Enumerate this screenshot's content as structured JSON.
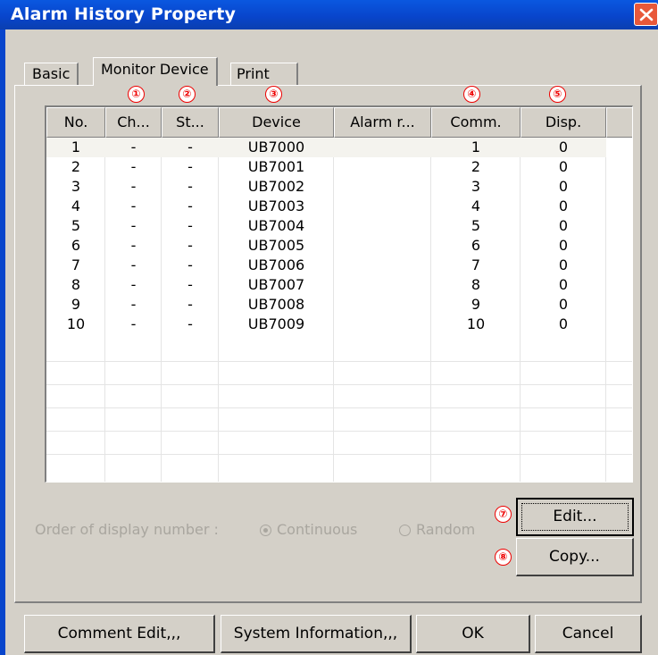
{
  "window": {
    "title": "Alarm History Property"
  },
  "tabs": [
    {
      "label": "Basic"
    },
    {
      "label": "Monitor Device"
    },
    {
      "label": "Print"
    }
  ],
  "markers": [
    "①",
    "②",
    "③",
    "④",
    "⑤",
    "⑦",
    "⑧"
  ],
  "grid": {
    "headers": [
      "No.",
      "Ch...",
      "St...",
      "Device",
      "Alarm r...",
      "Comm.",
      "Disp."
    ],
    "rows": [
      [
        "1",
        "-",
        "-",
        "UB7000",
        "",
        "1",
        "0"
      ],
      [
        "2",
        "-",
        "-",
        "UB7001",
        "",
        "2",
        "0"
      ],
      [
        "3",
        "-",
        "-",
        "UB7002",
        "",
        "3",
        "0"
      ],
      [
        "4",
        "-",
        "-",
        "UB7003",
        "",
        "4",
        "0"
      ],
      [
        "5",
        "-",
        "-",
        "UB7004",
        "",
        "5",
        "0"
      ],
      [
        "6",
        "-",
        "-",
        "UB7005",
        "",
        "6",
        "0"
      ],
      [
        "7",
        "-",
        "-",
        "UB7006",
        "",
        "7",
        "0"
      ],
      [
        "8",
        "-",
        "-",
        "UB7007",
        "",
        "8",
        "0"
      ],
      [
        "9",
        "-",
        "-",
        "UB7008",
        "",
        "9",
        "0"
      ],
      [
        "10",
        "-",
        "-",
        "UB7009",
        "",
        "10",
        "0"
      ]
    ]
  },
  "order": {
    "label": "Order of display number :",
    "options": [
      {
        "label": "Continuous",
        "selected": true
      },
      {
        "label": "Random",
        "selected": false
      }
    ]
  },
  "buttons": {
    "edit": "Edit...",
    "copy": "Copy...",
    "comment_edit": "Comment Edit,,,",
    "system_information": "System Information,,,",
    "ok": "OK",
    "cancel": "Cancel"
  },
  "colors": {
    "titlebar": "#0845cc",
    "marker": "#e00000",
    "dialog_bg": "#d4d0c8"
  }
}
